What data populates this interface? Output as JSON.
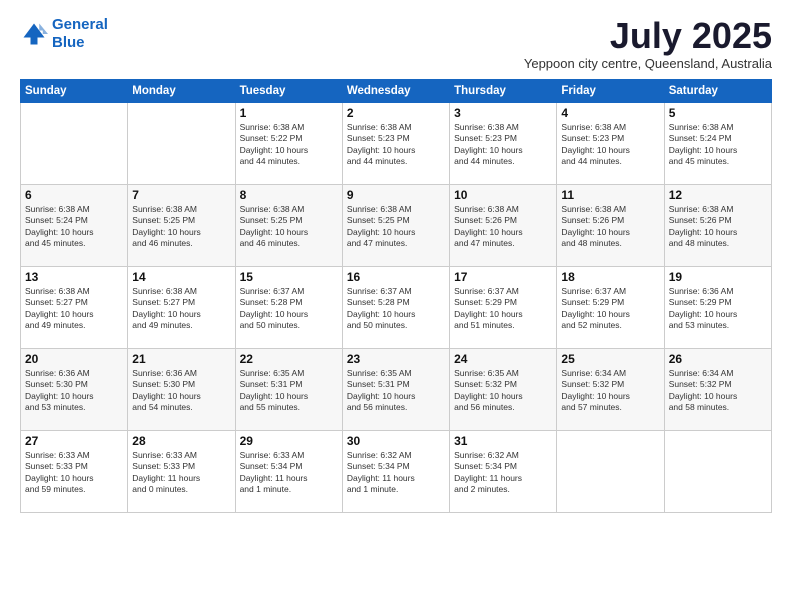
{
  "header": {
    "logo_line1": "General",
    "logo_line2": "Blue",
    "month_title": "July 2025",
    "location": "Yeppoon city centre, Queensland, Australia"
  },
  "columns": [
    "Sunday",
    "Monday",
    "Tuesday",
    "Wednesday",
    "Thursday",
    "Friday",
    "Saturday"
  ],
  "weeks": [
    [
      {
        "day": "",
        "text": ""
      },
      {
        "day": "",
        "text": ""
      },
      {
        "day": "1",
        "text": "Sunrise: 6:38 AM\nSunset: 5:22 PM\nDaylight: 10 hours\nand 44 minutes."
      },
      {
        "day": "2",
        "text": "Sunrise: 6:38 AM\nSunset: 5:23 PM\nDaylight: 10 hours\nand 44 minutes."
      },
      {
        "day": "3",
        "text": "Sunrise: 6:38 AM\nSunset: 5:23 PM\nDaylight: 10 hours\nand 44 minutes."
      },
      {
        "day": "4",
        "text": "Sunrise: 6:38 AM\nSunset: 5:23 PM\nDaylight: 10 hours\nand 44 minutes."
      },
      {
        "day": "5",
        "text": "Sunrise: 6:38 AM\nSunset: 5:24 PM\nDaylight: 10 hours\nand 45 minutes."
      }
    ],
    [
      {
        "day": "6",
        "text": "Sunrise: 6:38 AM\nSunset: 5:24 PM\nDaylight: 10 hours\nand 45 minutes."
      },
      {
        "day": "7",
        "text": "Sunrise: 6:38 AM\nSunset: 5:25 PM\nDaylight: 10 hours\nand 46 minutes."
      },
      {
        "day": "8",
        "text": "Sunrise: 6:38 AM\nSunset: 5:25 PM\nDaylight: 10 hours\nand 46 minutes."
      },
      {
        "day": "9",
        "text": "Sunrise: 6:38 AM\nSunset: 5:25 PM\nDaylight: 10 hours\nand 47 minutes."
      },
      {
        "day": "10",
        "text": "Sunrise: 6:38 AM\nSunset: 5:26 PM\nDaylight: 10 hours\nand 47 minutes."
      },
      {
        "day": "11",
        "text": "Sunrise: 6:38 AM\nSunset: 5:26 PM\nDaylight: 10 hours\nand 48 minutes."
      },
      {
        "day": "12",
        "text": "Sunrise: 6:38 AM\nSunset: 5:26 PM\nDaylight: 10 hours\nand 48 minutes."
      }
    ],
    [
      {
        "day": "13",
        "text": "Sunrise: 6:38 AM\nSunset: 5:27 PM\nDaylight: 10 hours\nand 49 minutes."
      },
      {
        "day": "14",
        "text": "Sunrise: 6:38 AM\nSunset: 5:27 PM\nDaylight: 10 hours\nand 49 minutes."
      },
      {
        "day": "15",
        "text": "Sunrise: 6:37 AM\nSunset: 5:28 PM\nDaylight: 10 hours\nand 50 minutes."
      },
      {
        "day": "16",
        "text": "Sunrise: 6:37 AM\nSunset: 5:28 PM\nDaylight: 10 hours\nand 50 minutes."
      },
      {
        "day": "17",
        "text": "Sunrise: 6:37 AM\nSunset: 5:29 PM\nDaylight: 10 hours\nand 51 minutes."
      },
      {
        "day": "18",
        "text": "Sunrise: 6:37 AM\nSunset: 5:29 PM\nDaylight: 10 hours\nand 52 minutes."
      },
      {
        "day": "19",
        "text": "Sunrise: 6:36 AM\nSunset: 5:29 PM\nDaylight: 10 hours\nand 53 minutes."
      }
    ],
    [
      {
        "day": "20",
        "text": "Sunrise: 6:36 AM\nSunset: 5:30 PM\nDaylight: 10 hours\nand 53 minutes."
      },
      {
        "day": "21",
        "text": "Sunrise: 6:36 AM\nSunset: 5:30 PM\nDaylight: 10 hours\nand 54 minutes."
      },
      {
        "day": "22",
        "text": "Sunrise: 6:35 AM\nSunset: 5:31 PM\nDaylight: 10 hours\nand 55 minutes."
      },
      {
        "day": "23",
        "text": "Sunrise: 6:35 AM\nSunset: 5:31 PM\nDaylight: 10 hours\nand 56 minutes."
      },
      {
        "day": "24",
        "text": "Sunrise: 6:35 AM\nSunset: 5:32 PM\nDaylight: 10 hours\nand 56 minutes."
      },
      {
        "day": "25",
        "text": "Sunrise: 6:34 AM\nSunset: 5:32 PM\nDaylight: 10 hours\nand 57 minutes."
      },
      {
        "day": "26",
        "text": "Sunrise: 6:34 AM\nSunset: 5:32 PM\nDaylight: 10 hours\nand 58 minutes."
      }
    ],
    [
      {
        "day": "27",
        "text": "Sunrise: 6:33 AM\nSunset: 5:33 PM\nDaylight: 10 hours\nand 59 minutes."
      },
      {
        "day": "28",
        "text": "Sunrise: 6:33 AM\nSunset: 5:33 PM\nDaylight: 11 hours\nand 0 minutes."
      },
      {
        "day": "29",
        "text": "Sunrise: 6:33 AM\nSunset: 5:34 PM\nDaylight: 11 hours\nand 1 minute."
      },
      {
        "day": "30",
        "text": "Sunrise: 6:32 AM\nSunset: 5:34 PM\nDaylight: 11 hours\nand 1 minute."
      },
      {
        "day": "31",
        "text": "Sunrise: 6:32 AM\nSunset: 5:34 PM\nDaylight: 11 hours\nand 2 minutes."
      },
      {
        "day": "",
        "text": ""
      },
      {
        "day": "",
        "text": ""
      }
    ]
  ]
}
